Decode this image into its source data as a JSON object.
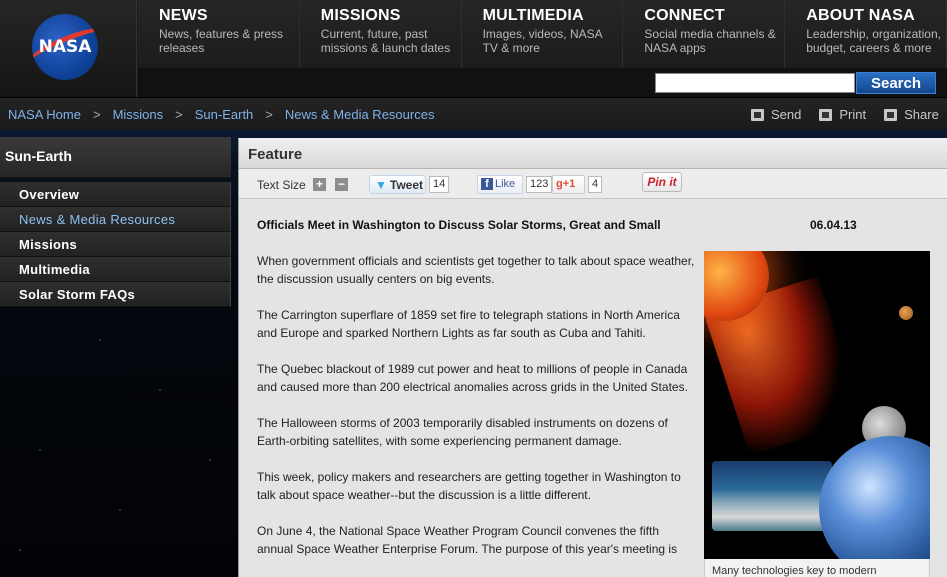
{
  "logo": {
    "text": "NASA"
  },
  "nav": [
    {
      "title": "NEWS",
      "desc": "News, features & press releases"
    },
    {
      "title": "MISSIONS",
      "desc": "Current, future, past missions & launch dates"
    },
    {
      "title": "MULTIMEDIA",
      "desc": "Images, videos, NASA TV & more"
    },
    {
      "title": "CONNECT",
      "desc": "Social media channels & NASA apps"
    },
    {
      "title": "ABOUT NASA",
      "desc": "Leadership, organization, budget, careers & more"
    }
  ],
  "search": {
    "placeholder": "",
    "button": "Search"
  },
  "breadcrumb": [
    {
      "label": "NASA Home"
    },
    {
      "label": "Missions"
    },
    {
      "label": "Sun-Earth"
    },
    {
      "label": "News & Media Resources"
    }
  ],
  "breadcrumb_sep": ">",
  "tools": {
    "send": "Send",
    "print": "Print",
    "share": "Share"
  },
  "sidebar": {
    "title": "Sun-Earth",
    "items": [
      {
        "label": "Overview"
      },
      {
        "label": "News & Media Resources"
      },
      {
        "label": "Missions"
      },
      {
        "label": "Multimedia"
      },
      {
        "label": "Solar Storm FAQs"
      }
    ]
  },
  "panel": {
    "title": "Feature",
    "text_size_label": "Text Size",
    "plus": "+",
    "minus": "−",
    "tweet_label": "Tweet",
    "tweet_count": "14",
    "like_label": "Like",
    "like_count": "123",
    "gplus_label": "+1",
    "gplus_count": "4",
    "pin_label": "Pin it"
  },
  "article": {
    "headline": "Officials Meet in Washington to Discuss Solar Storms, Great and Small",
    "date": "06.04.13",
    "paragraphs": [
      "When government officials and scientists get together to talk about space weather, the discussion usually centers on big events.",
      "The Carrington superflare of 1859 set fire to telegraph stations in North America and Europe and sparked Northern Lights as far south as Cuba and Tahiti.",
      "The Quebec blackout of 1989 cut power and heat to millions of people in Canada and caused more than 200 electrical anomalies across grids in the United States.",
      "The Halloween storms of 2003 temporarily disabled instruments on dozens of Earth-orbiting satellites, with some experiencing permanent damage.",
      "This week, policy makers and researchers are getting together in Washington to talk about space weather--but the discussion is a little different.",
      "On June 4, the National Space Weather Program Council convenes the fifth annual Space Weather Enterprise Forum. The purpose of this year's meeting is"
    ],
    "caption": "Many technologies key to modern"
  }
}
